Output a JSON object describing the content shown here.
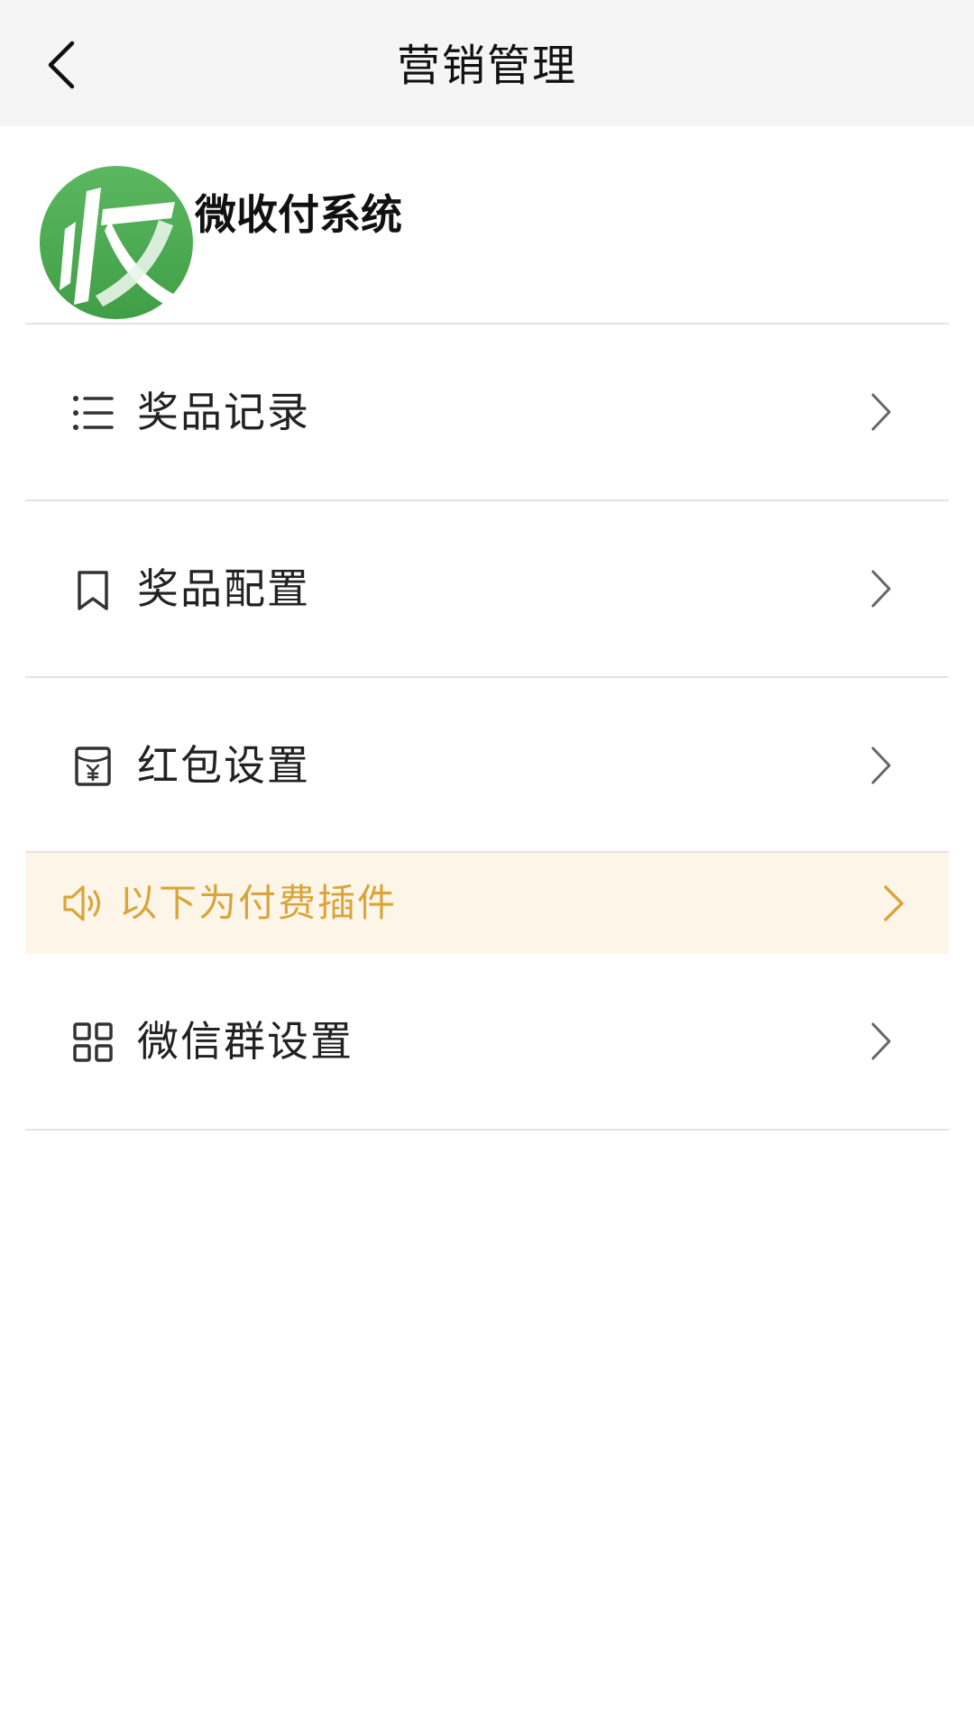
{
  "nav": {
    "title": "营销管理",
    "back_icon": "chevron-left-icon"
  },
  "brand": {
    "name": "微收付系统",
    "logo_icon": "shou-logo-icon",
    "logo_color": "#4caf50"
  },
  "menu": [
    {
      "label": "奖品记录",
      "icon": "list-icon"
    },
    {
      "label": "奖品配置",
      "icon": "bookmark-icon"
    },
    {
      "label": "红包设置",
      "icon": "red-envelope-icon"
    }
  ],
  "notice": {
    "text": "以下为付费插件",
    "icon": "speaker-icon",
    "color": "#d9a53b",
    "background": "#fdf6e8"
  },
  "plugins": [
    {
      "label": "微信群设置",
      "icon": "grid-icon"
    }
  ]
}
